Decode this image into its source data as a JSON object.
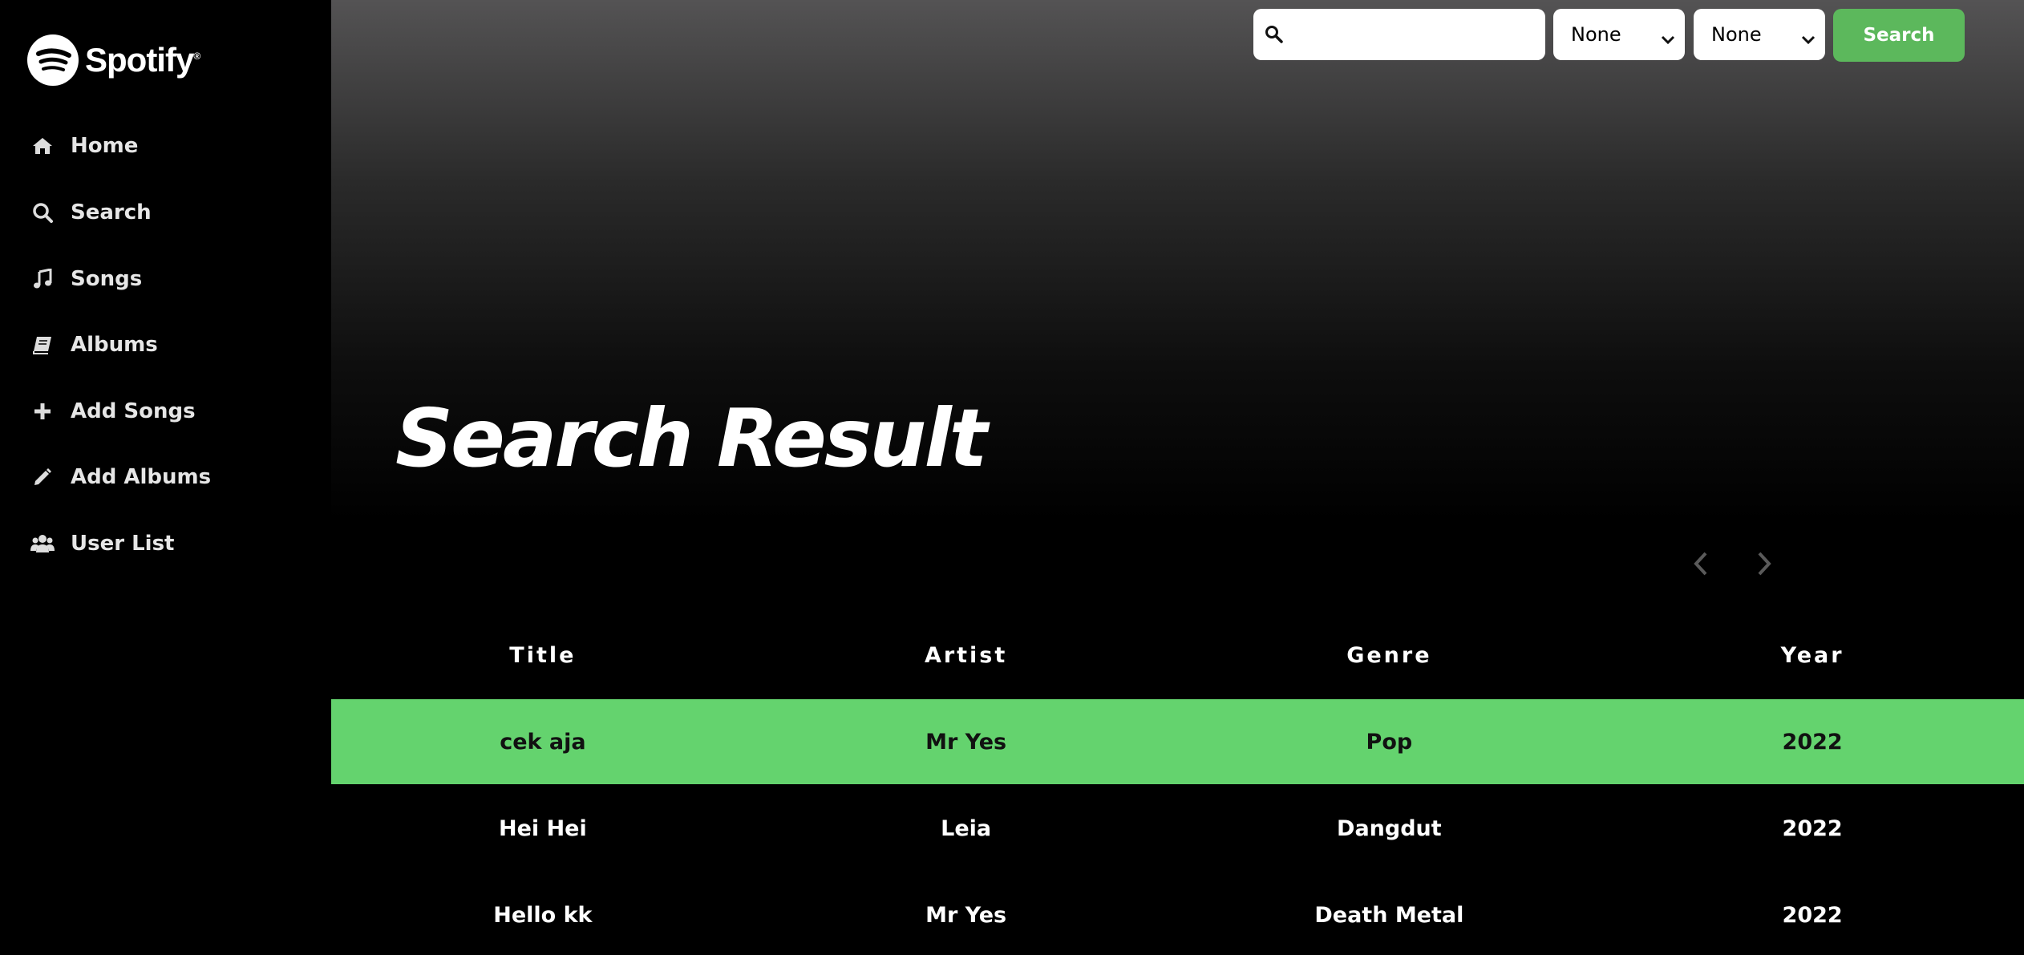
{
  "brand": {
    "name": "Spotify",
    "mark": "®"
  },
  "colors": {
    "accent": "#5cb85c",
    "active_row": "#64d36e",
    "sidebar": "#000000"
  },
  "sidebar": {
    "items": [
      {
        "label": "Home",
        "icon": "home-icon"
      },
      {
        "label": "Search",
        "icon": "search-icon"
      },
      {
        "label": "Songs",
        "icon": "music-note-icon"
      },
      {
        "label": "Albums",
        "icon": "book-icon"
      },
      {
        "label": "Add Songs",
        "icon": "plus-icon"
      },
      {
        "label": "Add Albums",
        "icon": "pencil-icon"
      },
      {
        "label": "User List",
        "icon": "users-icon"
      }
    ]
  },
  "search": {
    "placeholder": "",
    "value": "",
    "filter1": "None",
    "filter2": "None",
    "button_label": "Search"
  },
  "page": {
    "title": "Search Result"
  },
  "table": {
    "headers": [
      "Title",
      "Artist",
      "Genre",
      "Year"
    ],
    "rows": [
      [
        "cek aja",
        "Mr Yes",
        "Pop",
        "2022"
      ],
      [
        "Hei Hei",
        "Leia",
        "Dangdut",
        "2022"
      ],
      [
        "Hello kk",
        "Mr Yes",
        "Death Metal",
        "2022"
      ]
    ]
  }
}
